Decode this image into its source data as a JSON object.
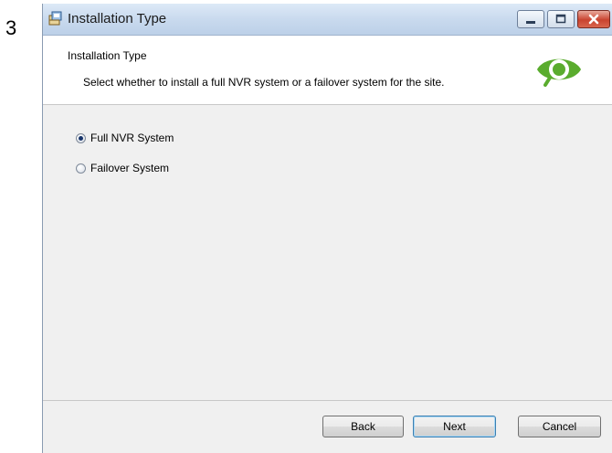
{
  "step_number": "3",
  "window": {
    "title": "Installation Type",
    "controls": {
      "minimize": "minimize-icon",
      "maximize": "maximize-icon",
      "close": "close-icon"
    }
  },
  "header": {
    "title": "Installation Type",
    "description": "Select whether to install a full NVR system or a failover system for the site.",
    "logo": "green-eye-logo"
  },
  "options": [
    {
      "label": "Full NVR System",
      "selected": true
    },
    {
      "label": "Failover System",
      "selected": false
    }
  ],
  "buttons": {
    "back": "Back",
    "next": "Next",
    "cancel": "Cancel"
  },
  "colors": {
    "logo_green": "#5aac2e",
    "close_red": "#c9432f",
    "title_bar": "#c9daee"
  }
}
